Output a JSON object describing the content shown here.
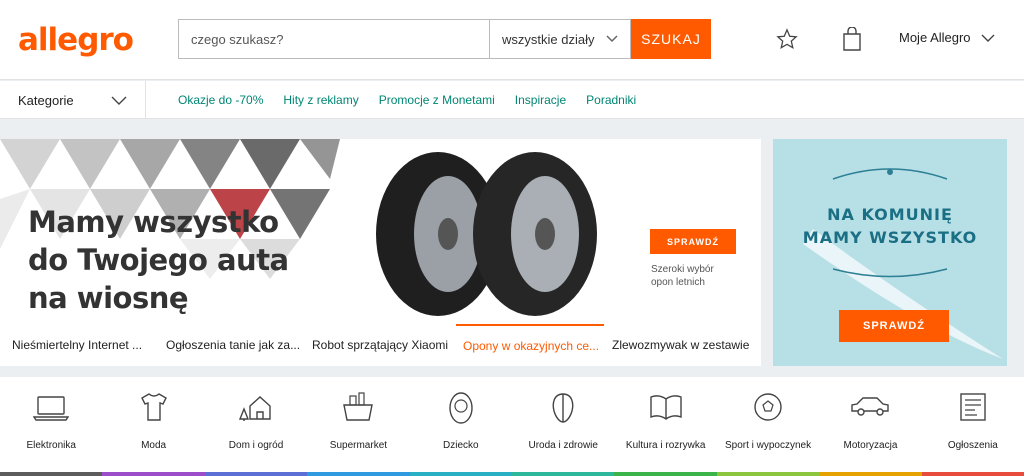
{
  "header": {
    "logo": "allegro",
    "search_placeholder": "czego szukasz?",
    "search_dept": "wszystkie działy",
    "search_button": "SZUKAJ",
    "account": "Moje Allegro"
  },
  "nav": {
    "categories": "Kategorie",
    "links": [
      "Okazje do -70%",
      "Hity z reklamy",
      "Promocje z Monetami",
      "Inspiracje",
      "Poradniki"
    ]
  },
  "banner": {
    "headline_lines": [
      "Mamy wszystko",
      "do Twojego auta",
      "na wiosnę"
    ],
    "cta": "SPRAWDŹ",
    "note_lines": [
      "Szeroki wybór",
      "opon letnich"
    ],
    "tabs": [
      {
        "label": "Nieśmiertelny Internet ...",
        "active": false
      },
      {
        "label": "Ogłoszenia tanie jak za...",
        "active": false
      },
      {
        "label": "Robot sprzątający Xiaomi",
        "active": false
      },
      {
        "label": "Opony w okazyjnych ce...",
        "active": true
      },
      {
        "label": "Zlewozmywak w zestawie",
        "active": false
      }
    ]
  },
  "side_banner": {
    "lines": [
      "NA KOMUNIĘ",
      "MAMY WSZYSTKO"
    ],
    "cta": "SPRAWDŹ"
  },
  "categories": [
    {
      "label": "Elektronika",
      "icon": "laptop-icon",
      "color": "#5c5c5c"
    },
    {
      "label": "Moda",
      "icon": "tshirt-icon",
      "color": "#9b4dca"
    },
    {
      "label": "Dom i ogród",
      "icon": "house-icon",
      "color": "#5b6fd6"
    },
    {
      "label": "Supermarket",
      "icon": "basket-icon",
      "color": "#2f9ae0"
    },
    {
      "label": "Dziecko",
      "icon": "baby-icon",
      "color": "#2ab0c5"
    },
    {
      "label": "Uroda i zdrowie",
      "icon": "face-icon",
      "color": "#2db79b"
    },
    {
      "label": "Kultura i rozrywka",
      "icon": "book-icon",
      "color": "#3bb54a"
    },
    {
      "label": "Sport i wypoczynek",
      "icon": "ball-icon",
      "color": "#8cc63e"
    },
    {
      "label": "Motoryzacja",
      "icon": "car-icon",
      "color": "#e6a200"
    },
    {
      "label": "Ogłoszenia",
      "icon": "newspaper-icon",
      "color": "#e84c3d"
    }
  ],
  "colors": {
    "accent": "#ff5a00",
    "link": "#008673"
  }
}
